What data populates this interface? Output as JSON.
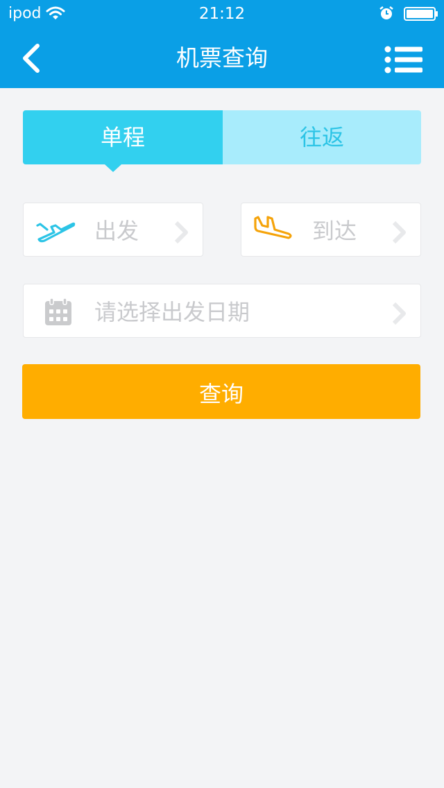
{
  "status_bar": {
    "carrier": "ipod",
    "time": "21:12",
    "icons": [
      "wifi-icon",
      "alarm-icon",
      "battery-icon"
    ]
  },
  "nav_bar": {
    "title": "机票查询",
    "back_icon": "chevron-left-icon",
    "menu_icon": "list-menu-icon",
    "background": "#0a9fe6"
  },
  "trip_tabs": [
    {
      "label": "单程",
      "selected": true
    },
    {
      "label": "往返",
      "selected": false
    }
  ],
  "form": {
    "departure_label": "出发",
    "departure_icon": "takeoff-plane-icon",
    "arrival_label": "到达",
    "arrival_icon": "landing-plane-icon",
    "date_placeholder": "请选择出发日期",
    "date_icon": "calendar-icon"
  },
  "search_button": {
    "label": "查询",
    "color": "#ffad00"
  },
  "colors": {
    "primary": "#0a9fe6",
    "tab_active": "#32d0ef",
    "tab_inactive": "#a8ecfc",
    "departure_icon": "#2cc4e6",
    "arrival_icon": "#f5a30a",
    "placeholder": "#c9cacd",
    "background": "#f3f4f6"
  }
}
